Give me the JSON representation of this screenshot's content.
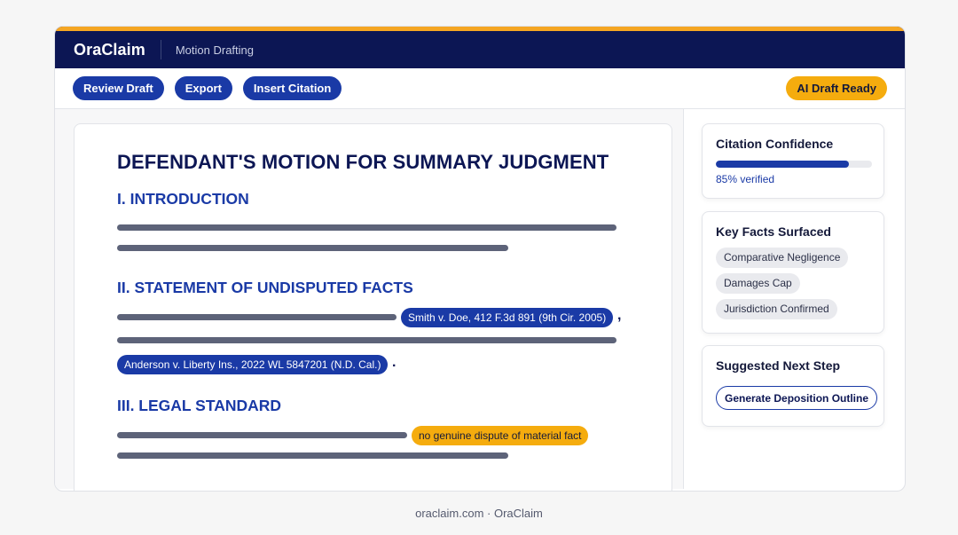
{
  "header": {
    "brand": "OraClaim",
    "section": "Motion Drafting"
  },
  "toolbar": {
    "review_label": "Review Draft",
    "export_label": "Export",
    "insert_citation_label": "Insert Citation",
    "status_badge": "AI Draft Ready"
  },
  "document": {
    "title": "DEFENDANT'S MOTION FOR SUMMARY JUDGMENT",
    "sections": [
      {
        "heading": "I. INTRODUCTION"
      },
      {
        "heading": "II. STATEMENT OF UNDISPUTED FACTS",
        "citations": [
          "Smith v. Doe, 412 F.3d 891 (9th Cir. 2005)",
          "Anderson v. Liberty Ins., 2022 WL 5847201 (N.D. Cal.)"
        ],
        "punctuation": [
          ",",
          "."
        ]
      },
      {
        "heading": "III. LEGAL STANDARD",
        "highlight": "no genuine dispute of material fact"
      }
    ]
  },
  "sidebar": {
    "confidence": {
      "title": "Citation Confidence",
      "value": 0.85,
      "label": "85% verified"
    },
    "key_facts": {
      "title": "Key Facts Surfaced",
      "items": [
        "Comparative Negligence",
        "Damages Cap",
        "Jurisdiction Confirmed"
      ]
    },
    "next_step": {
      "title": "Suggested Next Step",
      "button": "Generate Deposition Outline"
    }
  },
  "footer": {
    "text": "oraclaim.com · OraClaim"
  },
  "colors": {
    "navy": "#0c1654",
    "accent_blue": "#1a3aa6",
    "accent_orange": "#f5ac0e"
  }
}
